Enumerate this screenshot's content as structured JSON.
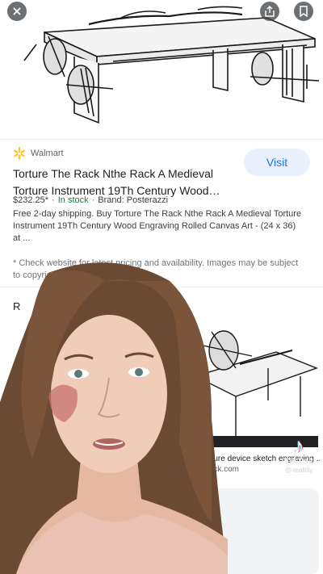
{
  "toolbar": {
    "close_icon": "close-icon",
    "share_icon": "share-icon",
    "bookmark_icon": "bookmark-icon"
  },
  "product": {
    "source": "Walmart",
    "visit_label": "Visit",
    "title": "Torture The Rack Nthe Rack A Medieval Torture Instrument 19Th Century Wood…",
    "price": "$232.25*",
    "stock": "In stock",
    "brand": "Brand: Posterazzi",
    "description": "Free 2-day shipping. Buy Torture The Rack Nthe Rack A Medieval Torture Instrument 19Th Century Wood Engraving Rolled Canvas Art - (24 x 36) at ...",
    "disclaimer": "* Check website for latest pricing and availability. Images may be subject to copyright. Learn More"
  },
  "related": {
    "heading": "R",
    "card_caption": "...ure device sketch engraving ...",
    "card_site": "...ck.com"
  },
  "overlay": {
    "app": "TikTok",
    "username": "@ reallilly"
  },
  "colors": {
    "accent": "#1a73e8",
    "stock_green": "#188038",
    "walmart_yellow": "#ffc220"
  }
}
